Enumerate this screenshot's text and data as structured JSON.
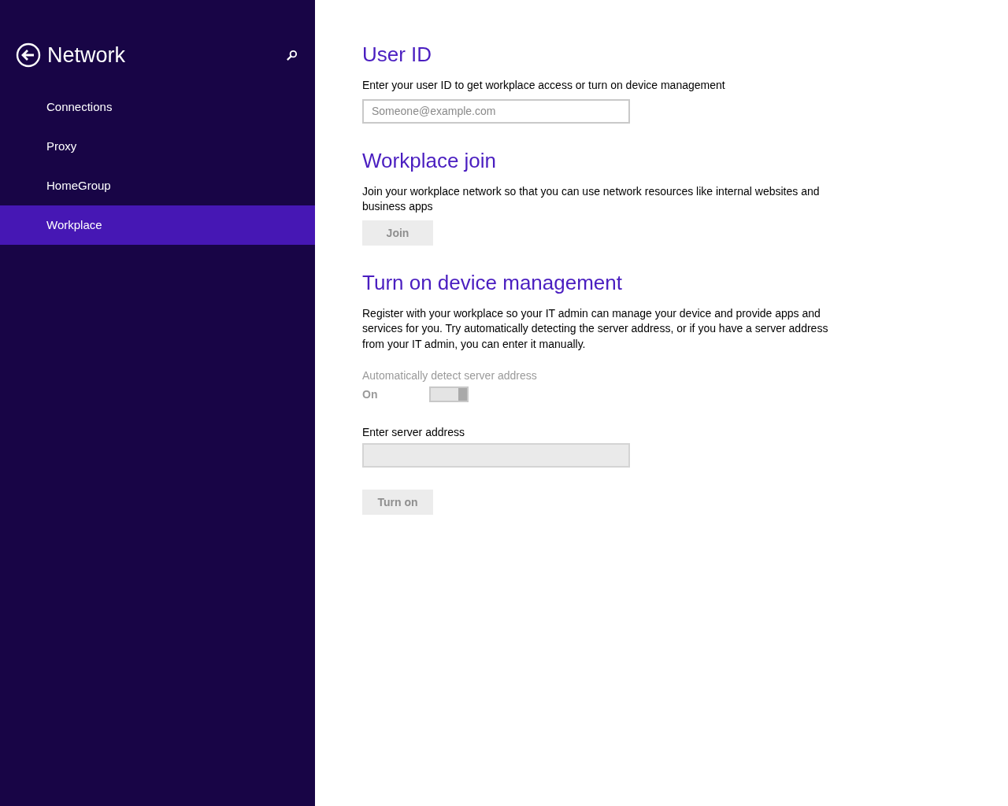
{
  "sidebar": {
    "title": "Network",
    "items": [
      {
        "label": "Connections",
        "selected": false
      },
      {
        "label": "Proxy",
        "selected": false
      },
      {
        "label": "HomeGroup",
        "selected": false
      },
      {
        "label": "Workplace",
        "selected": true
      }
    ]
  },
  "user_id": {
    "heading": "User ID",
    "description": "Enter your user ID to get workplace access or turn on device management",
    "field": {
      "placeholder": "Someone@example.com",
      "disabled": false
    }
  },
  "workplace_join": {
    "heading": "Workplace join",
    "description": "Join your workplace network so that you can use network resources like internal websites and business apps",
    "button": {
      "label": "Join",
      "disabled": true
    }
  },
  "device_management": {
    "heading": "Turn on device management",
    "description": "Register with your workplace so your IT admin can manage your device and provide apps and services for you. Try automatically detecting the server address, or if you have a server address from your IT admin, you can enter it manually.",
    "toggle": {
      "label": "Automatically detect server address",
      "state_text": "On",
      "on": true,
      "disabled": true
    },
    "server_field": {
      "label": "Enter server address",
      "disabled": true
    },
    "button": {
      "label": "Turn on",
      "disabled": true
    }
  }
}
